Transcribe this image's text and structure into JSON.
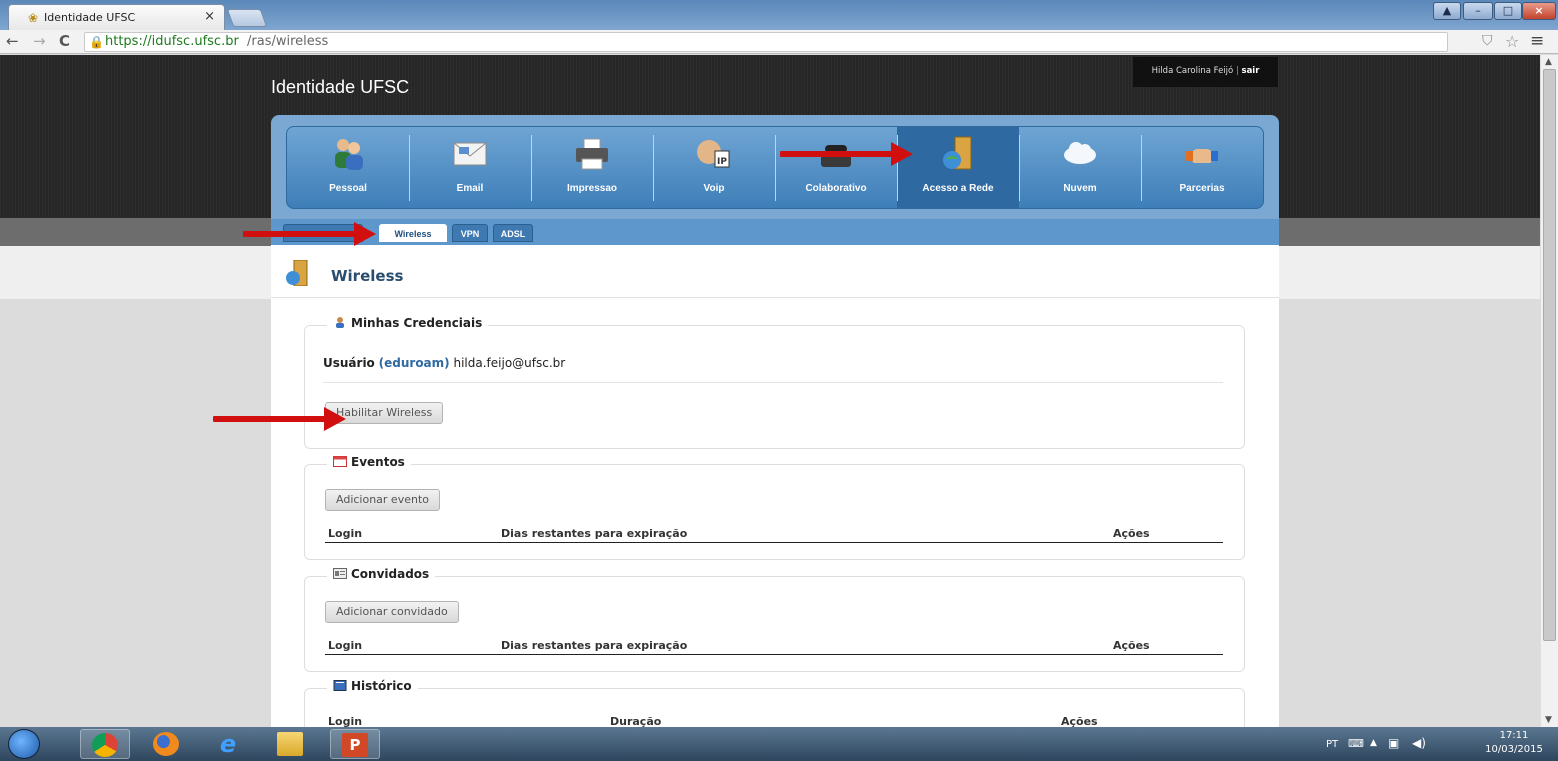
{
  "browser": {
    "tab_title": "Identidade UFSC",
    "tab_close": "×",
    "url_host": "https://idufsc.ufsc.br",
    "url_path": "/ras/wireless"
  },
  "header": {
    "site_title": "Identidade UFSC",
    "user_name": "Hilda Carolina Feijó",
    "separator": "|",
    "logout": "sair"
  },
  "nav": {
    "items": [
      {
        "label": "Pessoal",
        "icon": "users-icon"
      },
      {
        "label": "Email",
        "icon": "envelope-icon"
      },
      {
        "label": "Impressao",
        "icon": "printer-icon"
      },
      {
        "label": "Voip",
        "icon": "voip-phone-icon"
      },
      {
        "label": "Colaborativo",
        "icon": "telephone-icon"
      },
      {
        "label": "Acesso a Rede",
        "icon": "network-door-icon"
      },
      {
        "label": "Nuvem",
        "icon": "cloud-icon"
      },
      {
        "label": "Parcerias",
        "icon": "handshake-icon"
      }
    ],
    "active": "Acesso a Rede"
  },
  "subnav": {
    "tabs": [
      {
        "label": "Wireless",
        "active": true
      },
      {
        "label": "VPN",
        "active": false
      },
      {
        "label": "ADSL",
        "active": false
      }
    ]
  },
  "page": {
    "title": "Wireless"
  },
  "credentials": {
    "legend": "Minhas Credenciais",
    "user_label": "Usuário",
    "user_realm": "(eduroam)",
    "user_value": "hilda.feijo@ufsc.br",
    "enable_button": "Habilitar Wireless"
  },
  "events": {
    "legend": "Eventos",
    "add_button": "Adicionar evento",
    "columns": [
      "Login",
      "Dias restantes para expiração",
      "Ações"
    ]
  },
  "guests": {
    "legend": "Convidados",
    "add_button": "Adicionar convidado",
    "columns": [
      "Login",
      "Dias restantes para expiração",
      "Ações"
    ]
  },
  "history": {
    "legend": "Histórico",
    "columns": [
      "Login",
      "Duração",
      "Ações"
    ]
  },
  "taskbar": {
    "language": "PT",
    "time": "17:11",
    "date": "10/03/2015"
  },
  "colors": {
    "nav_blue": "#3e7eb8",
    "annotation_red": "#d10f0f",
    "link_blue": "#2f6aa0"
  }
}
